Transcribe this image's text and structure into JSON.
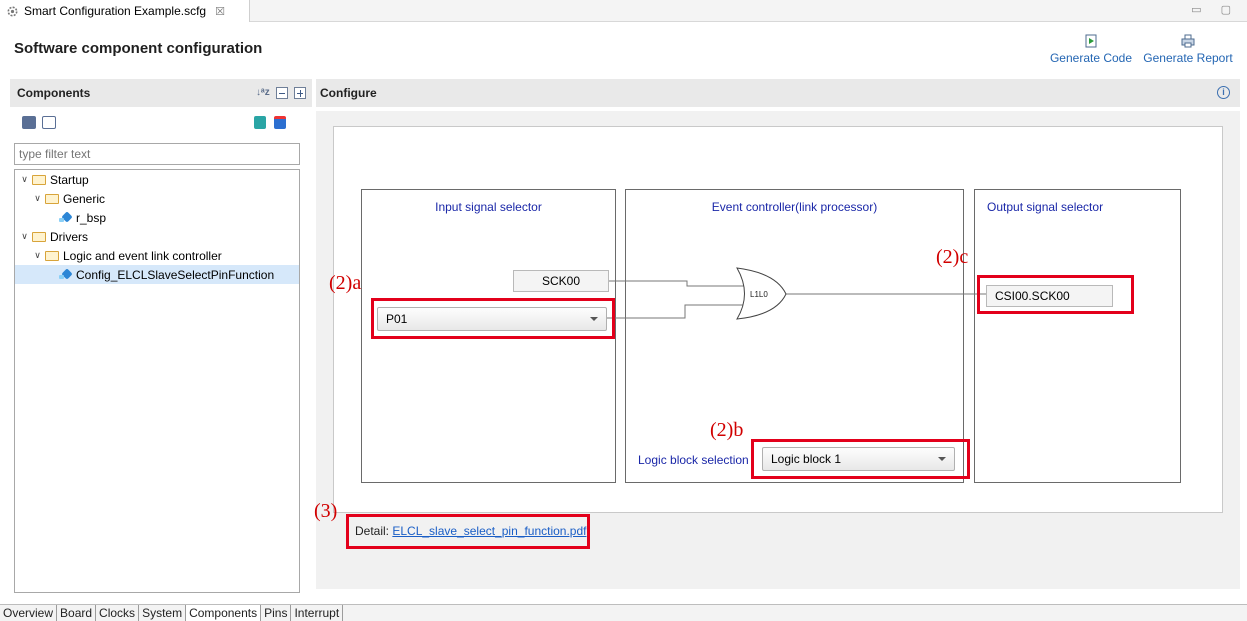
{
  "editor_tab": {
    "title": "Smart Configuration Example.scfg",
    "close": "☒"
  },
  "window_controls": "▭ ▢",
  "page_title": "Software component configuration",
  "toolbar": {
    "generate_code": "Generate Code",
    "generate_report": "Generate Report"
  },
  "components_panel": {
    "title": "Components",
    "filter_placeholder": "type filter text",
    "tree": [
      {
        "label": "Startup",
        "depth": 0,
        "type": "folder",
        "expanded": true
      },
      {
        "label": "Generic",
        "depth": 1,
        "type": "folder",
        "expanded": true
      },
      {
        "label": "r_bsp",
        "depth": 2,
        "type": "component"
      },
      {
        "label": "Drivers",
        "depth": 0,
        "type": "folder",
        "expanded": true
      },
      {
        "label": "Logic and event link controller",
        "depth": 1,
        "type": "folder",
        "expanded": true
      },
      {
        "label": "Config_ELCLSlaveSelectPinFunction",
        "depth": 2,
        "type": "component",
        "selected": true
      }
    ]
  },
  "configure_panel": {
    "title": "Configure",
    "info_icon": "i",
    "input_selector": {
      "title": "Input signal selector",
      "signal": "SCK00",
      "dropdown_value": "P01"
    },
    "event_controller": {
      "title": "Event controller(link processor)",
      "gate_label": "L1L0",
      "logic_block_label": "Logic block selection",
      "logic_block_value": "Logic block 1"
    },
    "output_selector": {
      "title": "Output signal selector",
      "signal": "CSI00.SCK00"
    },
    "detail_label": "Detail:",
    "detail_link": "ELCL_slave_select_pin_function.pdf"
  },
  "annotations": {
    "a": "(2)a",
    "b": "(2)b",
    "c": "(2)c",
    "d": "(3)"
  },
  "bottom_tabs": [
    "Overview",
    "Board",
    "Clocks",
    "System",
    "Components",
    "Pins",
    "Interrupt"
  ],
  "active_tab": "Components",
  "colors": {
    "annotation_red": "#e3001b",
    "title_blue": "#1a27a8",
    "link_blue": "#2466b3"
  }
}
